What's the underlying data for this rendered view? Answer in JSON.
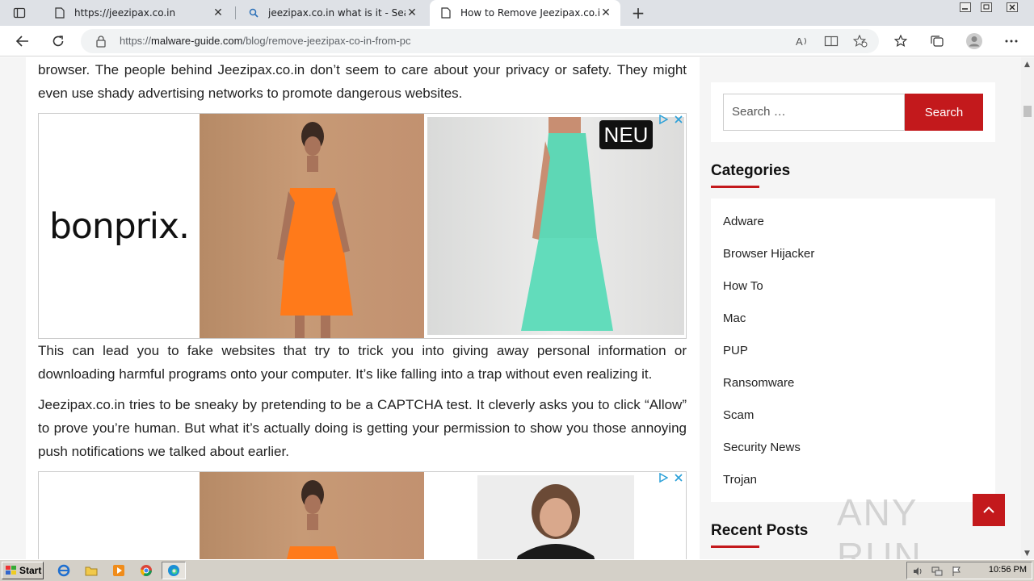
{
  "browser": {
    "tabs": [
      {
        "title": "https://jeezipax.co.in",
        "icon": "page-icon",
        "active": false
      },
      {
        "title": "jeezipax.co.in what is it - Search",
        "icon": "search-icon",
        "active": false
      },
      {
        "title": "How to Remove Jeezipax.co.in f",
        "icon": "page-icon",
        "active": true
      }
    ],
    "url_prefix": "https://",
    "url_host": "malware-guide.com",
    "url_path": "/blog/remove-jeezipax-co-in-from-pc"
  },
  "article": {
    "para1": "browser. The people behind Jeezipax.co.in don’t seem to care about your privacy or safety. They might even use shady advertising networks to promote dangerous websites.",
    "para2": "This can lead you to fake websites that try to trick you into giving away personal information or downloading harmful programs onto your computer. It’s like falling into a trap without even realizing it.",
    "para3": "Jeezipax.co.in tries to be sneaky by pretending to be a CAPTCHA test. It cleverly asks you to click “Allow” to prove you’re human. But what it’s actually doing is getting your permission to show you those annoying push notifications we talked about earlier."
  },
  "ad1": {
    "brand": "bonprix.",
    "badge": "NEU"
  },
  "sidebar": {
    "search_placeholder": "Search …",
    "search_button": "Search",
    "categories_title": "Categories",
    "categories": [
      "Adware",
      "Browser Hijacker",
      "How To",
      "Mac",
      "PUP",
      "Ransomware",
      "Scam",
      "Security News",
      "Trojan"
    ],
    "recent_title": "Recent Posts"
  },
  "watermark": "ANY RUN",
  "taskbar": {
    "start": "Start",
    "clock": "10:56 PM"
  },
  "colors": {
    "accent": "#c3191c",
    "tabstrip": "#dee1e6"
  }
}
